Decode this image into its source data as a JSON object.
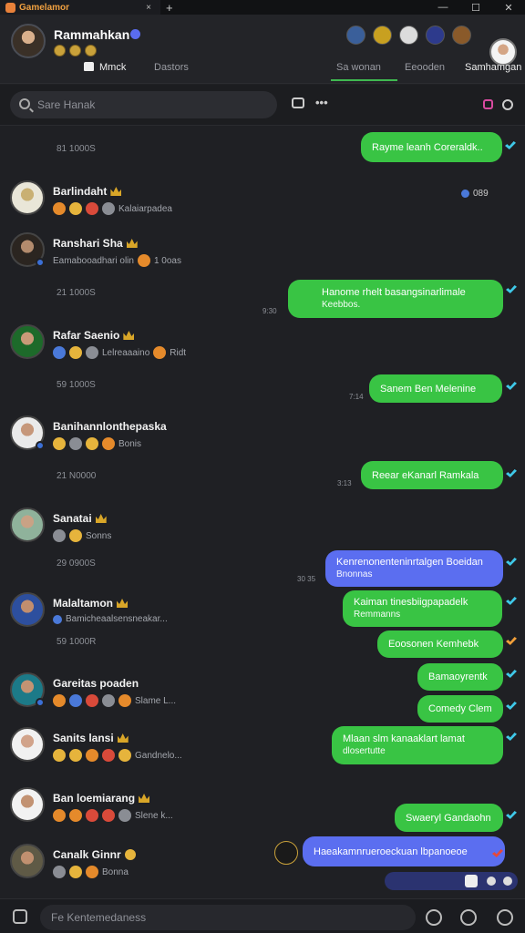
{
  "window": {
    "title": "Gamelamor",
    "close_tab": "×",
    "new_tab": "+",
    "minimize": "—",
    "maximize": "☐",
    "close": "✕"
  },
  "profile": {
    "name": "Rammahkan"
  },
  "tabs": {
    "home": "Mmck",
    "second": "Dastors",
    "third": "Sa wonan",
    "fourth": "Eeooden",
    "fifth": "Samhamgan"
  },
  "search": {
    "placeholder": "Sare Hanak",
    "more": "•••"
  },
  "sections": {
    "s1": "81 1000S",
    "s2": "21 1000S",
    "s3": "59 1000S",
    "s4": "21 N0000",
    "s5": "29 0900S",
    "s6": "59 1000R"
  },
  "contacts": [
    {
      "name": "Barlindaht",
      "sub": "Kalaiarpadea"
    },
    {
      "name": "Ranshari Sha",
      "sub": "Eamabooadhari olin",
      "extra": "1 0oas"
    },
    {
      "name": "Rafar Saenio",
      "sub": "Lelreaaaino",
      "extra": "Ridt"
    },
    {
      "name": "Banihannlonthepaska",
      "sub": "Bonis"
    },
    {
      "name": "Sanatai",
      "sub": "Sonns"
    },
    {
      "name": "Malaltamon",
      "sub": "Bamicheaalsensneakar..."
    },
    {
      "name": "Gareitas poaden",
      "sub": "Slame L..."
    },
    {
      "name": "Sanits lansi",
      "sub": "Gandnelo..."
    },
    {
      "name": "Ban loemiarang",
      "sub": "Slene k..."
    },
    {
      "name": "Canalk Ginnr",
      "sub": "Bonna"
    }
  ],
  "badge_top": "089",
  "messages": [
    {
      "text": "Rayme leanh Coreraldk.."
    },
    {
      "text": "Hanome rhelt basangsinarlimale",
      "text2": "Keebbos.",
      "time": "9:30"
    },
    {
      "text": "Sanem Ben Melenine",
      "time": "7:14"
    },
    {
      "text": "Reear eKanarl Ramkala",
      "time": "3:13"
    },
    {
      "text": "Kenrenonenteninrtalgen Boeidan",
      "text2": "Bnonnas",
      "time": "30 35"
    },
    {
      "text": "Kaiman tinesbiigpapadelk",
      "text2": "Remmanns"
    },
    {
      "text": "Eoosonen Kemhebk"
    },
    {
      "text": "Bamaoyrentk"
    },
    {
      "text": "Comedy Clem"
    },
    {
      "text": "Mlaan slm kanaaklart lamat",
      "text2": "dlosertutte"
    },
    {
      "text": "Swaeryl Gandaohn"
    },
    {
      "text": "Haeakamnrueroeckuan lbpanoeoe"
    }
  ],
  "composer": {
    "placeholder": "Fe Kentemedaness"
  }
}
